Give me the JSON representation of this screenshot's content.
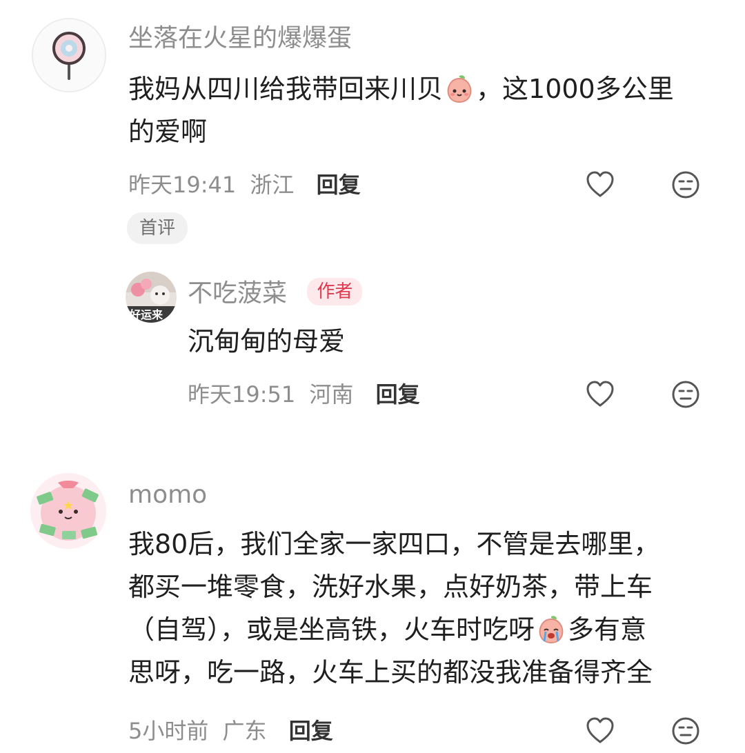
{
  "comments": [
    {
      "username": "坐落在火星的爆爆蛋",
      "text_before_emoji": "我妈从四川给我带回来川贝",
      "emoji": "peach-face-emoji",
      "text_after_emoji": "，这1000多公里\n的爱啊",
      "time": "昨天19:41",
      "location": "浙江",
      "reply_label": "回复",
      "tag": "首评",
      "replies": [
        {
          "username": "不吃菠菜",
          "badge": "作者",
          "avatar_text": "好运来",
          "text": "沉甸甸的母爱",
          "time": "昨天19:51",
          "location": "河南",
          "reply_label": "回复"
        }
      ]
    },
    {
      "username": "momo",
      "text_before_emoji": "我80后，我们全家一家四口，不管是去哪里，\n都买一堆零食，洗好水果，点好奶茶，带上车\n（自驾），或是坐高铁，火车时吃呀",
      "emoji": "crying-peach-emoji",
      "text_after_emoji": "多有意\n思呀，吃一路，火车上买的都没我准备得齐全",
      "time": "5小时前",
      "location": "广东",
      "reply_label": "回复"
    }
  ],
  "icons": {
    "like": "heart-outline-icon",
    "dislike": "meh-face-icon"
  },
  "colors": {
    "author_badge_bg": "#fde9ec",
    "author_badge_text": "#e0384d",
    "meta_gray": "#8d8d8d"
  }
}
